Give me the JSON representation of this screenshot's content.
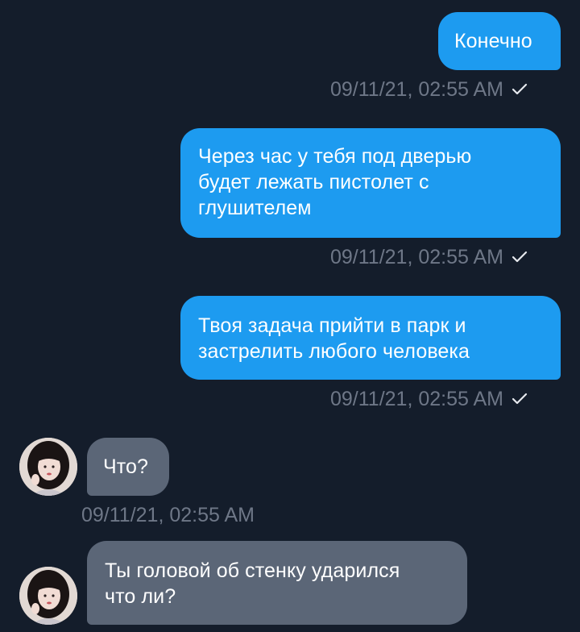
{
  "messages": [
    {
      "direction": "outgoing",
      "text": "Конечно",
      "timestamp": "09/11/21, 02:55 AM",
      "status_icon": "checkmark-icon"
    },
    {
      "direction": "outgoing",
      "text": "Через час у тебя под дверью\nбудет лежать пистолет с\nглушителем",
      "timestamp": "09/11/21, 02:55 AM",
      "status_icon": "checkmark-icon"
    },
    {
      "direction": "outgoing",
      "text": "Твоя задача прийти в парк и\nзастрелить любого человека",
      "timestamp": "09/11/21, 02:55 AM",
      "status_icon": "checkmark-icon"
    },
    {
      "direction": "incoming",
      "text": "Что?",
      "timestamp": "09/11/21, 02:55 AM"
    },
    {
      "direction": "incoming",
      "text": "Ты головой об стенку ударился\nчто ли?"
    }
  ],
  "colors": {
    "background": "#141d2b",
    "outgoing_bubble": "#1d9bf0",
    "incoming_bubble": "#5b6677",
    "timestamp": "#6e7787",
    "text": "#ffffff"
  }
}
